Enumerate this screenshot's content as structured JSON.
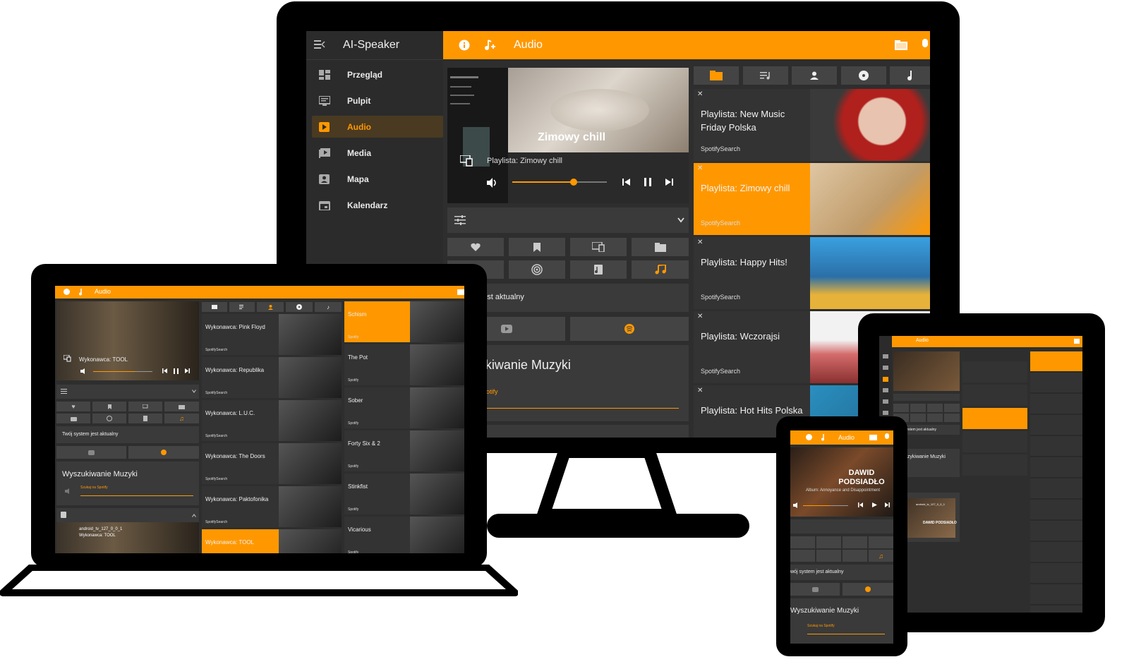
{
  "colors": {
    "accent": "#ff9800",
    "panel": "#303030",
    "sidebar": "#2b2b2b",
    "frame": "#000000"
  },
  "monitor": {
    "app_title": "AI-Speaker",
    "page_title": "Audio",
    "nav": [
      {
        "label": "Przegląd",
        "icon": "dashboard-icon",
        "active": false
      },
      {
        "label": "Pulpit",
        "icon": "desktop-icon",
        "active": false
      },
      {
        "label": "Audio",
        "icon": "play-box-icon",
        "active": true
      },
      {
        "label": "Media",
        "icon": "media-icon",
        "active": false
      },
      {
        "label": "Mapa",
        "icon": "map-icon",
        "active": false
      },
      {
        "label": "Kalendarz",
        "icon": "calendar-icon",
        "active": false
      }
    ],
    "player": {
      "cover_title": "Zimowy chill",
      "now_playing": "Playlista: Zimowy chill",
      "progress": 0.65
    },
    "status_text": "System jest aktualny",
    "search_title": "Wyszukiwanie Muzyki",
    "search_placeholder": "Szukaj na Spotify",
    "playlists": [
      {
        "title": "Playlista: New Music Friday Polska",
        "source": "SpotifySearch",
        "selected": false
      },
      {
        "title": "Playlista: Zimowy chill",
        "source": "SpotifySearch",
        "selected": true
      },
      {
        "title": "Playlista: Happy Hits!",
        "source": "SpotifySearch",
        "selected": false
      },
      {
        "title": "Playlista: Wczorajsi",
        "source": "SpotifySearch",
        "selected": false
      },
      {
        "title": "Playlista: Hot Hits Polska",
        "source": "",
        "selected": false
      }
    ],
    "partial_text_wcz": "Wc"
  },
  "laptop": {
    "page_title": "Audio",
    "player_artist": "Wykonawca: TOOL",
    "status_text": "Twój system jest aktualny",
    "search_title": "Wyszukiwanie Muzyki",
    "search_placeholder": "Szukaj na Spotify",
    "device_name": "android_tv_127_0_0_1",
    "device_artist": "Wykonawca: TOOL",
    "artists": [
      {
        "title": "Wykonawca: Pink Floyd",
        "source": "SpotifySearch",
        "selected": false
      },
      {
        "title": "Wykonawca: Republika",
        "source": "SpotifySearch",
        "selected": false
      },
      {
        "title": "Wykonawca: L.U.C.",
        "source": "SpotifySearch",
        "selected": false
      },
      {
        "title": "Wykonawca: The Doors",
        "source": "SpotifySearch",
        "selected": false
      },
      {
        "title": "Wykonawca: Paktofonika",
        "source": "SpotifySearch",
        "selected": false
      },
      {
        "title": "Wykonawca: TOOL",
        "source": "",
        "selected": true
      }
    ],
    "tracks": [
      {
        "title": "Schism",
        "source": "Spotify",
        "selected": true
      },
      {
        "title": "The Pot",
        "source": "Spotify",
        "selected": false
      },
      {
        "title": "Sober",
        "source": "Spotify",
        "selected": false
      },
      {
        "title": "Forty Six & 2",
        "source": "Spotify",
        "selected": false
      },
      {
        "title": "Stinkfist",
        "source": "Spotify",
        "selected": false
      },
      {
        "title": "Vicarious",
        "source": "Spotify",
        "selected": false
      }
    ]
  },
  "phone": {
    "page_title": "Audio",
    "cover_artist": "DAWID PODSIADŁO",
    "album_line": "Album: Annoyance and Disappointment",
    "status_text": "wój system jest aktualny",
    "search_title": "Wyszukiwanie Muzyki",
    "search_placeholder": "Szukaj na Spotify"
  },
  "tablet": {
    "page_title": "Audio",
    "status_text": "system jest aktualny",
    "search_title": "uzykiwanie Muzyki",
    "device_name": "android_tv_127_0_0_1",
    "cover_artist": "DAWID PODSIADŁO"
  }
}
